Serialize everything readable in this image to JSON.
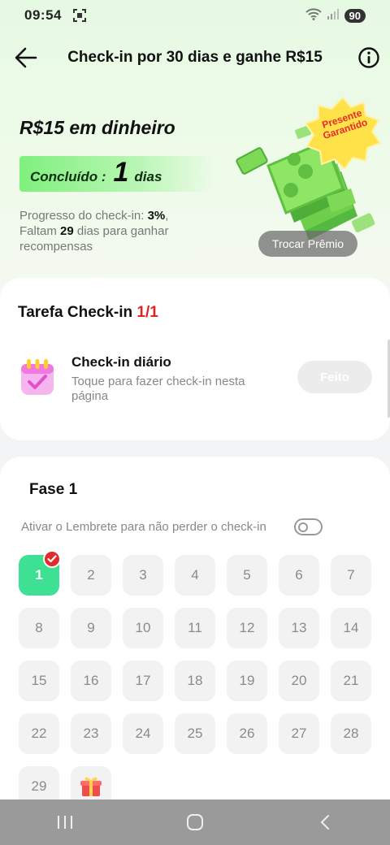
{
  "status_bar": {
    "time": "09:54",
    "battery": "90"
  },
  "header": {
    "title": "Check-in por 30 dias e ganhe R$15"
  },
  "reward": {
    "amount": "R$15 em dinheiro",
    "done_label": "Concluído :",
    "done_count": "1",
    "done_unit": "dias",
    "progress_prefix": "Progresso do check-in: ",
    "progress_percent": "3%",
    "remaining_prefix": ",\nFaltam ",
    "remaining_days": "29",
    "remaining_suffix": " dias para ganhar recompensas",
    "badge": "Presente Garantido",
    "trade_button": "Trocar Prêmio"
  },
  "task": {
    "title": "Tarefa Check-in ",
    "count": "1/1",
    "name": "Check-in diário",
    "description": "Toque para fazer check-in nesta página",
    "button": "Feito"
  },
  "phase": {
    "title": "Fase 1",
    "reminder": "Ativar o Lembrete para não perder o check-in",
    "reminder_on": false,
    "days": [
      "1",
      "2",
      "3",
      "4",
      "5",
      "6",
      "7",
      "8",
      "9",
      "10",
      "11",
      "12",
      "13",
      "14",
      "15",
      "16",
      "17",
      "18",
      "19",
      "20",
      "21",
      "22",
      "23",
      "24",
      "25",
      "26",
      "27",
      "28",
      "29"
    ],
    "checked_days": [
      "1"
    ],
    "final_reward_icon": "gift-icon"
  },
  "colors": {
    "accent_green": "#3ee094",
    "check_red": "#e42b2b",
    "count_red": "#e02424"
  }
}
